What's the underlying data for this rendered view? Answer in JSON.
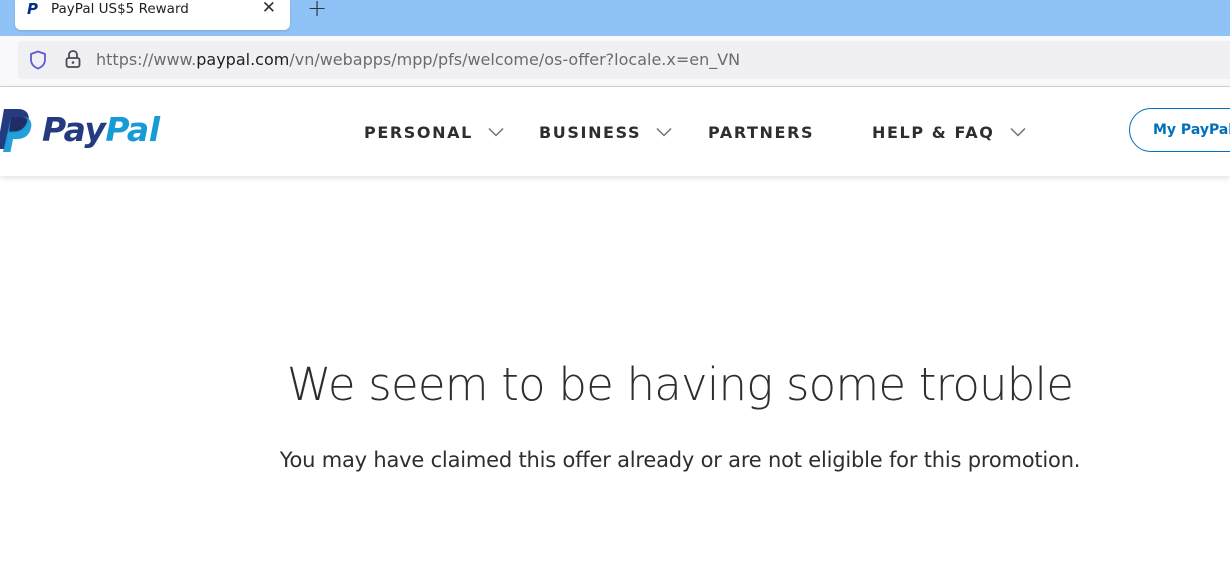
{
  "browser": {
    "tab": {
      "title": "PayPal US$5 Reward",
      "favicon": "paypal-p-icon",
      "close_glyph": "✕"
    },
    "new_tab_glyph": "+",
    "address": {
      "url_prefix": "https://www.",
      "url_domain": "paypal.com",
      "url_path": "/vn/webapps/mpp/pfs/welcome/os-offer?locale.x=en_VN"
    }
  },
  "site": {
    "logo": {
      "part1": "Pay",
      "part2": "Pal"
    },
    "nav": {
      "personal": "PERSONAL",
      "business": "BUSINESS",
      "partners": "PARTNERS",
      "help": "HELP & FAQ"
    },
    "my_paypal_label": "My PayPal"
  },
  "message": {
    "headline": "We seem to be having some trouble",
    "detail": "You may have claimed this offer already or are not eligible for this promotion."
  },
  "colors": {
    "tabstrip": "#8fc3f7",
    "brand_dark": "#253b80",
    "brand_light": "#179bd7",
    "link_blue": "#0070ba"
  }
}
